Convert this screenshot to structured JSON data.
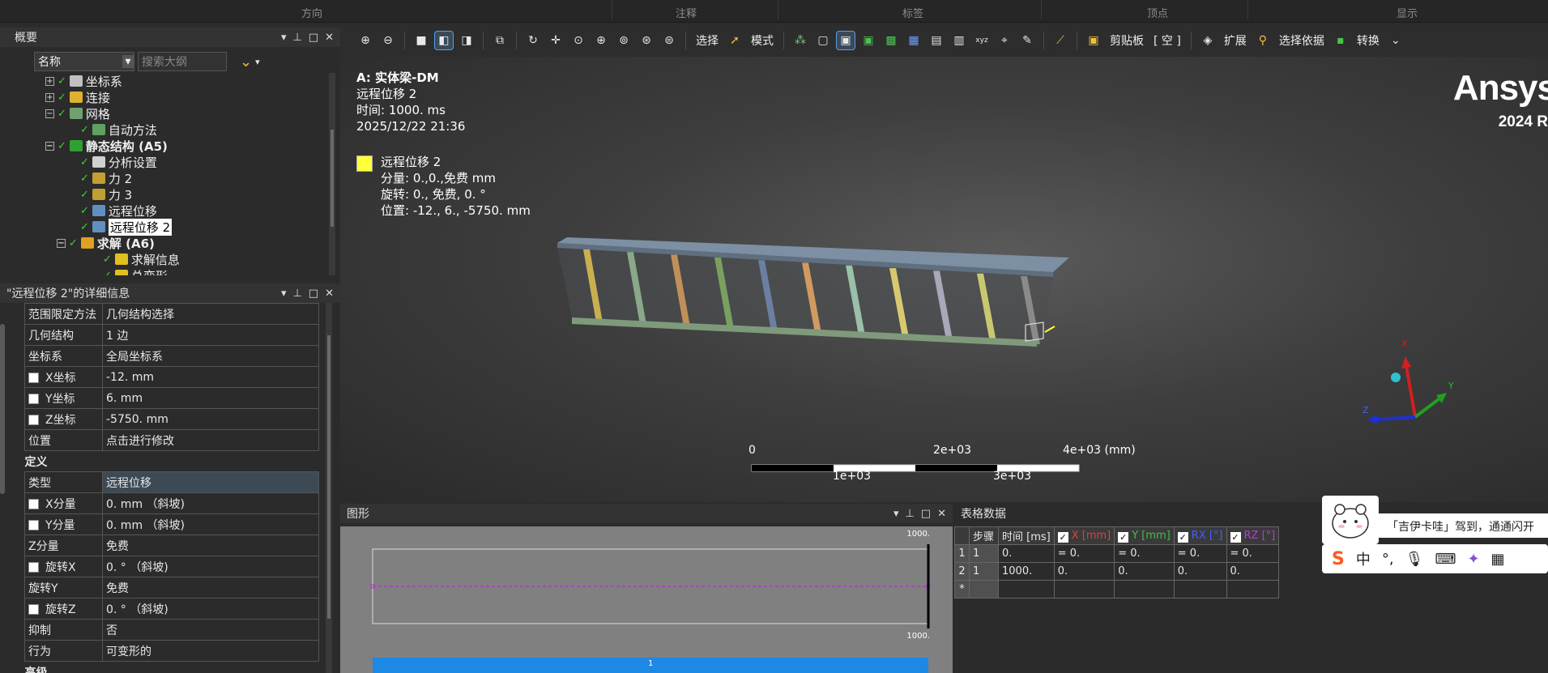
{
  "ribbon": {
    "groups": [
      "方向",
      "注释",
      "标签",
      "顶点",
      "显示"
    ]
  },
  "toolbar": {
    "select_label": "选择",
    "mode_label": "模式",
    "clipboard_label": "剪贴板",
    "empty_label": "[ 空 ]",
    "extend_label": "扩展",
    "select_by_label": "选择依据",
    "convert_label": "转换"
  },
  "outline": {
    "title": "概要",
    "name_filter": "名称",
    "search_placeholder": "搜索大纲",
    "items": [
      {
        "label": "坐标系",
        "indent": 0,
        "expander": "+",
        "icon_color": "#c0c0c0"
      },
      {
        "label": "连接",
        "indent": 0,
        "expander": "+",
        "icon_color": "#e0b030"
      },
      {
        "label": "网格",
        "indent": 0,
        "expander": "-",
        "icon_color": "#70a070"
      },
      {
        "label": "自动方法",
        "indent": 1,
        "expander": "",
        "icon_color": "#60a060"
      },
      {
        "label": "静态结构 (A5)",
        "indent": 0,
        "expander": "-",
        "icon_color": "#30a030",
        "bold": true
      },
      {
        "label": "分析设置",
        "indent": 1,
        "expander": "",
        "icon_color": "#d0d0d0"
      },
      {
        "label": "力 2",
        "indent": 1,
        "expander": "",
        "icon_color": "#c0a030"
      },
      {
        "label": "力 3",
        "indent": 1,
        "expander": "",
        "icon_color": "#c0a030"
      },
      {
        "label": "远程位移",
        "indent": 1,
        "expander": "",
        "icon_color": "#6090c0"
      },
      {
        "label": "远程位移 2",
        "indent": 1,
        "expander": "",
        "icon_color": "#6090c0",
        "selected": true
      },
      {
        "label": "求解 (A6)",
        "indent": 0.5,
        "expander": "-",
        "icon_color": "#e0a020",
        "bold": true
      },
      {
        "label": "求解信息",
        "indent": 2,
        "expander": "",
        "icon_color": "#e0c020"
      },
      {
        "label": "总变形",
        "indent": 2,
        "expander": "",
        "icon_color": "#e0c020"
      }
    ]
  },
  "details": {
    "title": "\"远程位移 2\"的详细信息",
    "rows": [
      {
        "k": "范围限定方法",
        "v": "几何结构选择"
      },
      {
        "k": "几何结构",
        "v": "1 边"
      },
      {
        "k": "坐标系",
        "v": "全局坐标系"
      },
      {
        "k": "X坐标",
        "v": "-12. mm",
        "cb": true
      },
      {
        "k": "Y坐标",
        "v": "6. mm",
        "cb": true
      },
      {
        "k": "Z坐标",
        "v": "-5750. mm",
        "cb": true
      },
      {
        "k": "位置",
        "v": "点击进行修改"
      }
    ],
    "section": "定义",
    "def_rows": [
      {
        "k": "类型",
        "v": "远程位移",
        "hl": true
      },
      {
        "k": "X分量",
        "v": "0. mm （斜坡)",
        "cb": true
      },
      {
        "k": "Y分量",
        "v": "0. mm （斜坡)",
        "cb": true
      },
      {
        "k": "Z分量",
        "v": "免费"
      },
      {
        "k": "旋转X",
        "v": "0. ° （斜坡)",
        "cb": true
      },
      {
        "k": "旋转Y",
        "v": "免费"
      },
      {
        "k": "旋转Z",
        "v": "0. ° （斜坡)",
        "cb": true
      },
      {
        "k": "抑制",
        "v": "否"
      },
      {
        "k": "行为",
        "v": "可变形的"
      }
    ],
    "section2": "高级"
  },
  "viewport": {
    "model_prefix": "A: ",
    "model_name": "实体梁-DM",
    "result_name": "远程位移 2",
    "time_text": "时间: 1000. ms",
    "date_text": "2025/12/22 21:36",
    "legend_title": "远程位移 2",
    "legend_line1": "分量: 0.,0.,免费 mm",
    "legend_line2": "旋转: 0., 免费, 0. °",
    "legend_line3": "位置: -12., 6., -5750. mm",
    "logo": "Ansys",
    "version": "2024 R",
    "scale_top": [
      "0",
      "2e+03",
      "4e+03 (mm)"
    ],
    "scale_bottom": [
      "1e+03",
      "3e+03"
    ],
    "axes": {
      "x": "X",
      "y": "Y",
      "z": "Z"
    }
  },
  "graph": {
    "title": "图形",
    "y_top": "1000.",
    "x_right": "1000.",
    "step_label": "1"
  },
  "tabular": {
    "title": "表格数据",
    "headers": [
      "步骤",
      "时间 [ms]",
      "X [mm]",
      "Y [mm]",
      "RX [°]",
      "RZ [°]"
    ],
    "header_colors": [
      "#e6e6e6",
      "#e6e6e6",
      "#e04040",
      "#40c040",
      "#4060ff",
      "#b040d0"
    ],
    "rows": [
      {
        "n": "1",
        "cells": [
          "1",
          "0.",
          "= 0.",
          "= 0.",
          "= 0.",
          "= 0."
        ]
      },
      {
        "n": "2",
        "cells": [
          "1",
          "1000.",
          "0.",
          "0.",
          "0.",
          "0."
        ]
      },
      {
        "n": "*",
        "cells": [
          "",
          "",
          "",
          "",
          "",
          ""
        ]
      }
    ]
  },
  "ime": {
    "notice": "「吉伊卡哇」驾到，通通闪开",
    "cn": "中"
  }
}
